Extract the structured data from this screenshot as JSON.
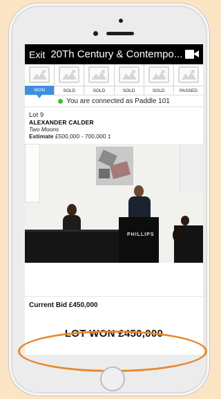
{
  "header": {
    "exit_label": "Exit",
    "title": "20Th Century & Contempo...",
    "video_icon": "video-camera-icon"
  },
  "lots": [
    {
      "status": "WON"
    },
    {
      "status": "SOLD"
    },
    {
      "status": "SOLD"
    },
    {
      "status": "SOLD"
    },
    {
      "status": "SOLD"
    },
    {
      "status": "PASSED"
    }
  ],
  "connection": {
    "text": "You are connected as Paddle 101",
    "status_color": "#2fc43a"
  },
  "lot": {
    "number": "Lot 9",
    "artist": "ALEXANDER CALDER",
    "work": "Two Moons",
    "estimate_label": "Estimate",
    "estimate_value": "£500,000 - 700,000 ‡"
  },
  "photo": {
    "podium_label": "PHILLIPS"
  },
  "bid": {
    "current_bid": "Current Bid £450,000",
    "result": "LOT WON £450,000"
  },
  "colors": {
    "accent": "#3d8fe0",
    "highlight": "#e8872a",
    "background": "#fbe4c4"
  }
}
